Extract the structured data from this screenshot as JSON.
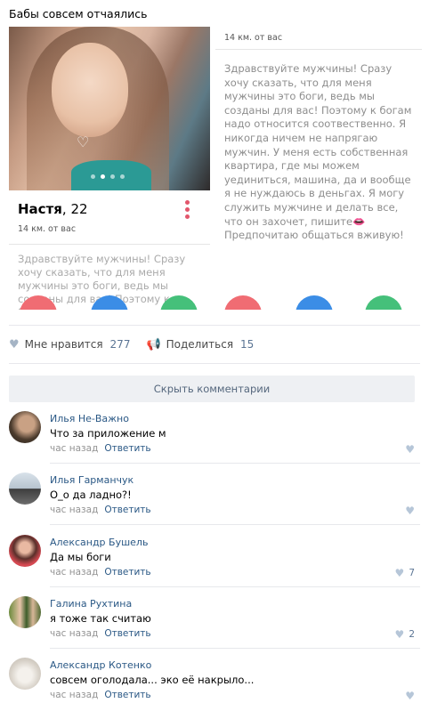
{
  "post": {
    "text": "Бабы совсем отчаялись"
  },
  "card_left": {
    "name": "Настя",
    "age": ", 22",
    "distance": "14 км. от вас",
    "bio": "Здравствуйте мужчины! Сразу хочу сказать, что для меня мужчины это боги, ведь мы созданы для вас! Поэтому к богам надо относится"
  },
  "card_right": {
    "distance": "14 км. от вас",
    "bio": "Здравствуйте мужчины! Сразу хочу сказать, что для меня мужчины это боги, ведь мы созданы для вас! Поэтому к богам надо относится соотвественно. Я никогда ничем не напрягаю мужчин. У меня есть собственная  квартира, где мы можем уединиться, машина, да и вообще я не нуждаюсь в деньгах. Я могу служить мужчине и делать все, что он захочет, пишите👄 Предпочитаю общаться вживую!"
  },
  "actions": {
    "like_label": "Мне нравится",
    "like_count": "277",
    "share_label": "Поделиться",
    "share_count": "15"
  },
  "hide_comments": "Скрыть комментарии",
  "comments": [
    {
      "name": "Илья Не-Важно",
      "text": "Что за приложение м",
      "time": "час назад",
      "reply": "Ответить",
      "likes": ""
    },
    {
      "name": "Илья Гарманчук",
      "text": "О_о да ладно?!",
      "time": "час назад",
      "reply": "Ответить",
      "likes": ""
    },
    {
      "name": "Александр Бушель",
      "text": "Да мы боги",
      "time": "час назад",
      "reply": "Ответить",
      "likes": "7"
    },
    {
      "name": "Галина Рухтина",
      "text": "я тоже так считаю",
      "time": "час назад",
      "reply": "Ответить",
      "likes": "2"
    },
    {
      "name": "Александр Котенко",
      "text": "совсем оголодала... эко её накрыло...",
      "time": "час назад",
      "reply": "Ответить",
      "likes": ""
    }
  ],
  "colors": {
    "link": "#2a5885",
    "accent_red": "#e2566b"
  },
  "icons": {
    "like": "heart-icon",
    "share": "megaphone-icon"
  }
}
